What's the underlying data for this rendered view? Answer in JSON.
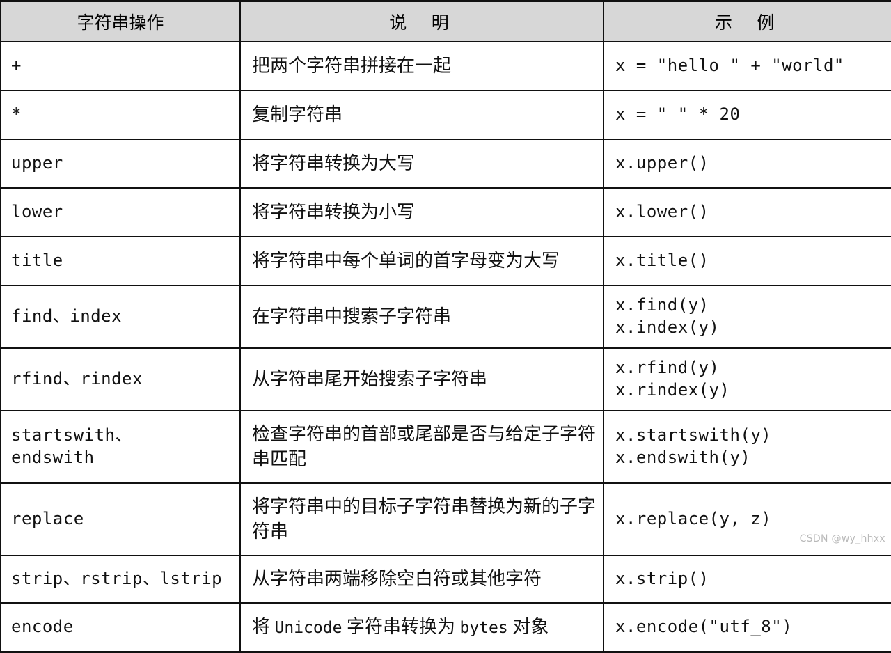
{
  "table": {
    "headers": [
      {
        "label": "字符串操作",
        "spaced": false
      },
      {
        "label": "说 明",
        "spaced": true
      },
      {
        "label": "示 例",
        "spaced": true
      }
    ],
    "rows": [
      {
        "operation": "+",
        "description": "把两个字符串拼接在一起",
        "example": "x = \"hello \" + \"world\""
      },
      {
        "operation": "*",
        "description": "复制字符串",
        "example": "x = \" \" * 20"
      },
      {
        "operation": "upper",
        "description": "将字符串转换为大写",
        "example": "x.upper()"
      },
      {
        "operation": "lower",
        "description": "将字符串转换为小写",
        "example": "x.lower()"
      },
      {
        "operation": "title",
        "description": "将字符串中每个单词的首字母变为大写",
        "example": "x.title()"
      },
      {
        "operation": "find、index",
        "description": "在字符串中搜索子字符串",
        "example": "x.find(y)\nx.index(y)"
      },
      {
        "operation": "rfind、rindex",
        "description": "从字符串尾开始搜索子字符串",
        "example": "x.rfind(y)\nx.rindex(y)"
      },
      {
        "operation": "startswith、\nendswith",
        "description": "检查字符串的首部或尾部是否与给定子字符串匹配",
        "example": "x.startswith(y)\nx.endswith(y)"
      },
      {
        "operation": "replace",
        "description": "将字符串中的目标子字符串替换为新的子字符串",
        "example": "x.replace(y, z)"
      },
      {
        "operation": "strip、rstrip、lstrip",
        "description": "从字符串两端移除空白符或其他字符",
        "example": "x.strip()"
      },
      {
        "operation": "encode",
        "description": "将 Unicode 字符串转换为 bytes 对象",
        "example": "x.encode(\"utf_8\")"
      }
    ]
  },
  "watermark": {
    "text": "CSDN @wy_hhxx"
  },
  "colors": {
    "header_background": "#d7d7d7",
    "border": "#111111",
    "cell_background": "#ffffff",
    "watermark_text": "#b9b9b9"
  }
}
